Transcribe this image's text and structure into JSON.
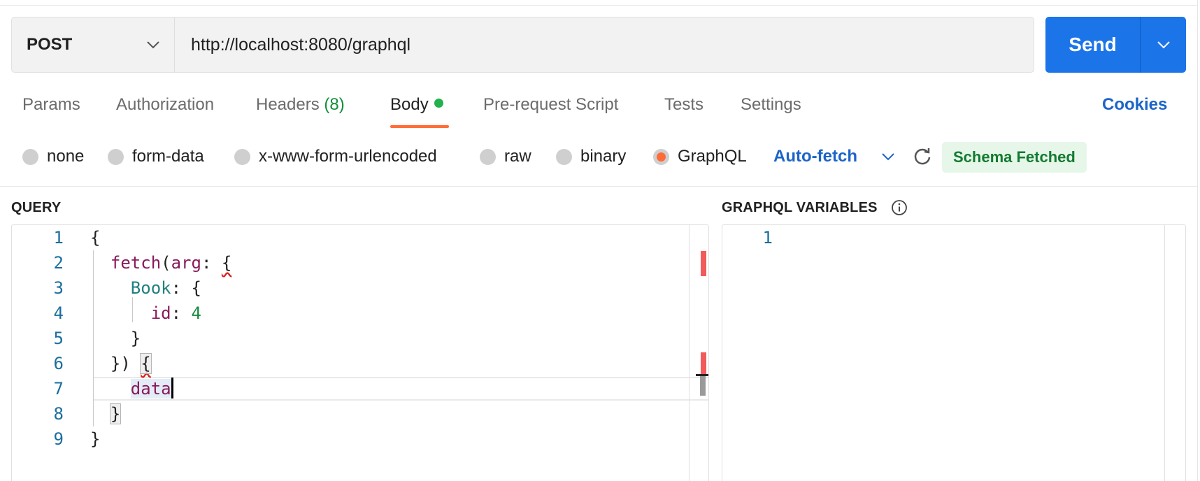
{
  "request": {
    "method": "POST",
    "url": "http://localhost:8080/graphql",
    "send_label": "Send"
  },
  "tabs": [
    {
      "label": "Params"
    },
    {
      "label": "Authorization"
    },
    {
      "label": "Headers",
      "count": "(8)"
    },
    {
      "label": "Body",
      "active": true
    },
    {
      "label": "Pre-request Script"
    },
    {
      "label": "Tests"
    },
    {
      "label": "Settings"
    }
  ],
  "cookies_label": "Cookies",
  "body_types": [
    {
      "label": "none"
    },
    {
      "label": "form-data"
    },
    {
      "label": "x-www-form-urlencoded"
    },
    {
      "label": "raw"
    },
    {
      "label": "binary"
    },
    {
      "label": "GraphQL",
      "selected": true
    }
  ],
  "graphql": {
    "autofetch_label": "Auto-fetch",
    "schema_status": "Schema Fetched",
    "query_title": "QUERY",
    "variables_title": "GRAPHQL VARIABLES",
    "query_lines": [
      "1",
      "2",
      "3",
      "4",
      "5",
      "6",
      "7",
      "8",
      "9"
    ],
    "variables_lines": [
      "1"
    ]
  },
  "colors": {
    "accent_orange": "#ff6c37",
    "send_blue": "#1c74e9",
    "link_blue": "#1c64c8",
    "success_green": "#137a30",
    "error_marker": "#f25b5b"
  }
}
